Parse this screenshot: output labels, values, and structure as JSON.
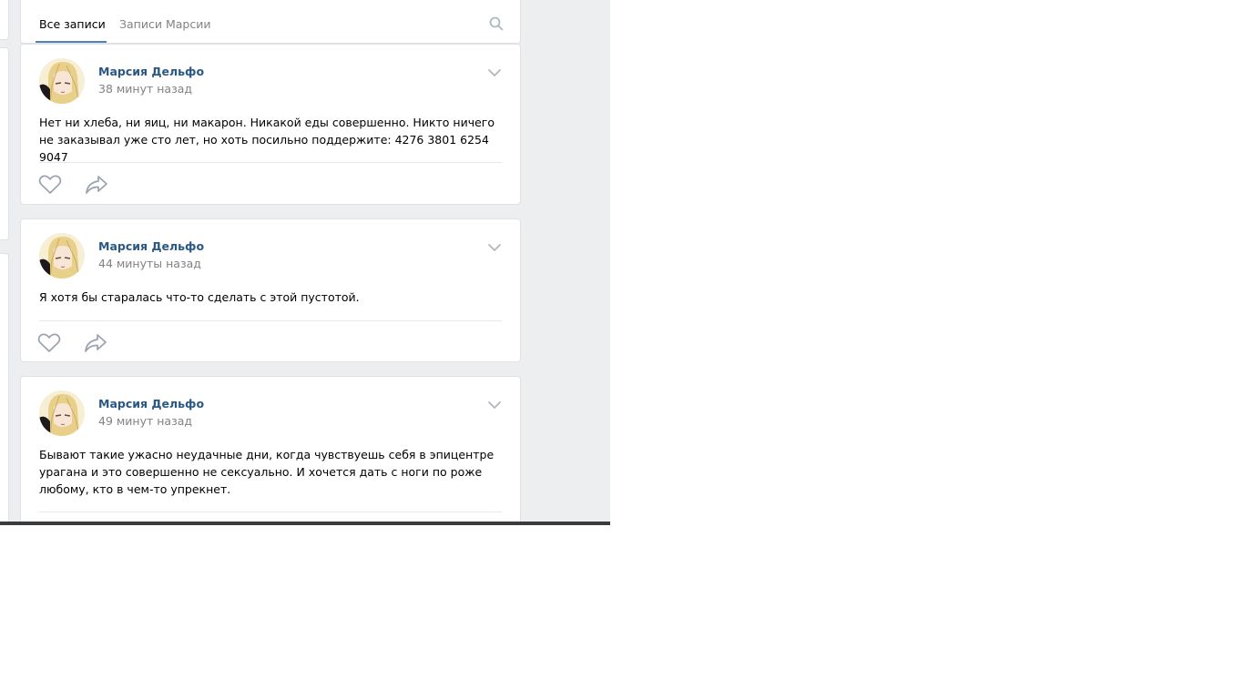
{
  "tabs": {
    "all_posts": "Все записи",
    "owner_posts": "Записи Марсии"
  },
  "icons": {
    "search": "search-icon",
    "chevron": "chevron-down-icon",
    "like": "heart-icon",
    "share": "share-arrow-icon"
  },
  "colors": {
    "link": "#2a5885",
    "accent": "#5181b8",
    "background": "#edeef0",
    "muted_text": "#828282"
  },
  "posts": [
    {
      "author": "Марсия Дельфо",
      "time": "38 минут назад",
      "text": "Нет ни хлеба, ни яиц, ни макарон. Никакой еды совершенно. Никто ничего не заказывал уже сто лет, но хоть посильно поддержите: 4276 3801 6254 9047"
    },
    {
      "author": "Марсия Дельфо",
      "time": "44 минуты назад",
      "text": "Я хотя бы старалась что-то сделать с этой пустотой."
    },
    {
      "author": "Марсия Дельфо",
      "time": "49 минут назад",
      "text": "Бывают такие ужасно неудачные дни, когда чувствуешь себя в эпицентре урагана и это совершенно не сексуально. И хочется дать с ноги по роже любому, кто в чем-то упрекнет."
    }
  ]
}
